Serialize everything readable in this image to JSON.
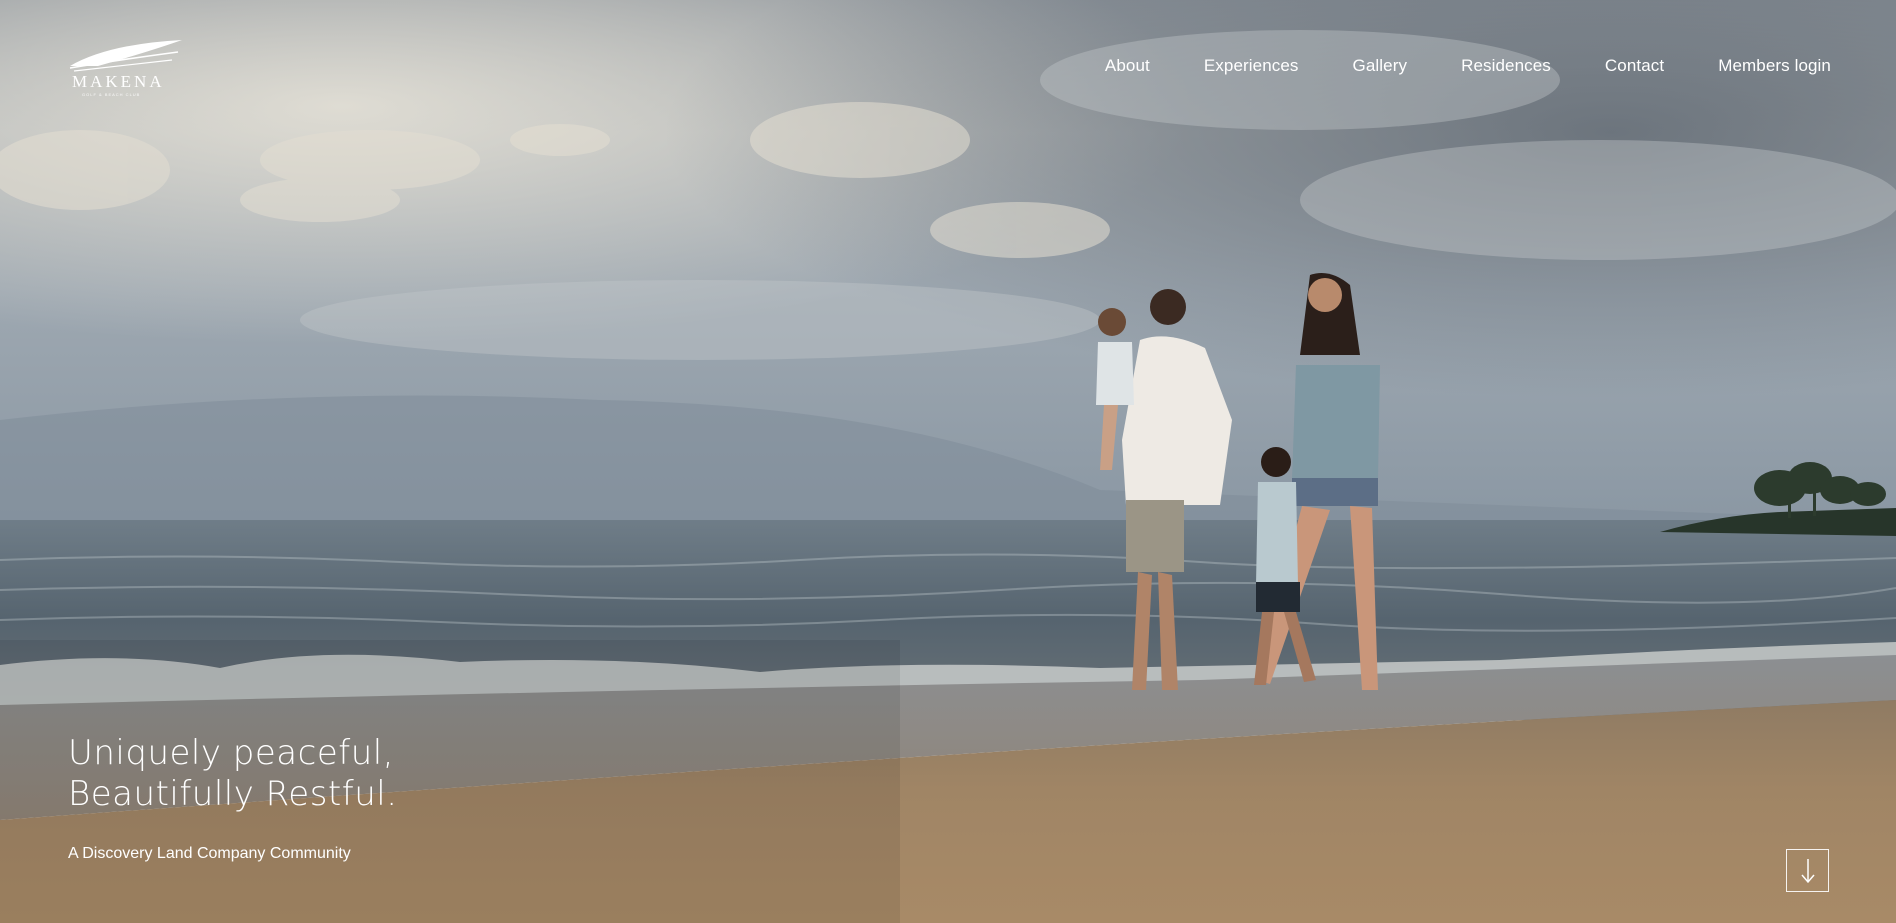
{
  "brand": {
    "name": "MAKENA",
    "tagline": "GOLF & BEACH CLUB",
    "logo_icon": "wave-sail-icon"
  },
  "nav": {
    "items": [
      {
        "label": "About"
      },
      {
        "label": "Experiences"
      },
      {
        "label": "Gallery"
      },
      {
        "label": "Residences"
      },
      {
        "label": "Contact"
      },
      {
        "label": "Members login"
      }
    ]
  },
  "hero": {
    "headline_line1": "Uniquely peaceful,",
    "headline_line2": "Beautifully Restful.",
    "subheadline": "A Discovery Land Company Community",
    "scroll_icon": "arrow-down-icon"
  },
  "colors": {
    "text": "#ffffff",
    "sky": "#9aa6b1",
    "ocean": "#5b6b78",
    "sand": "#a58966"
  }
}
